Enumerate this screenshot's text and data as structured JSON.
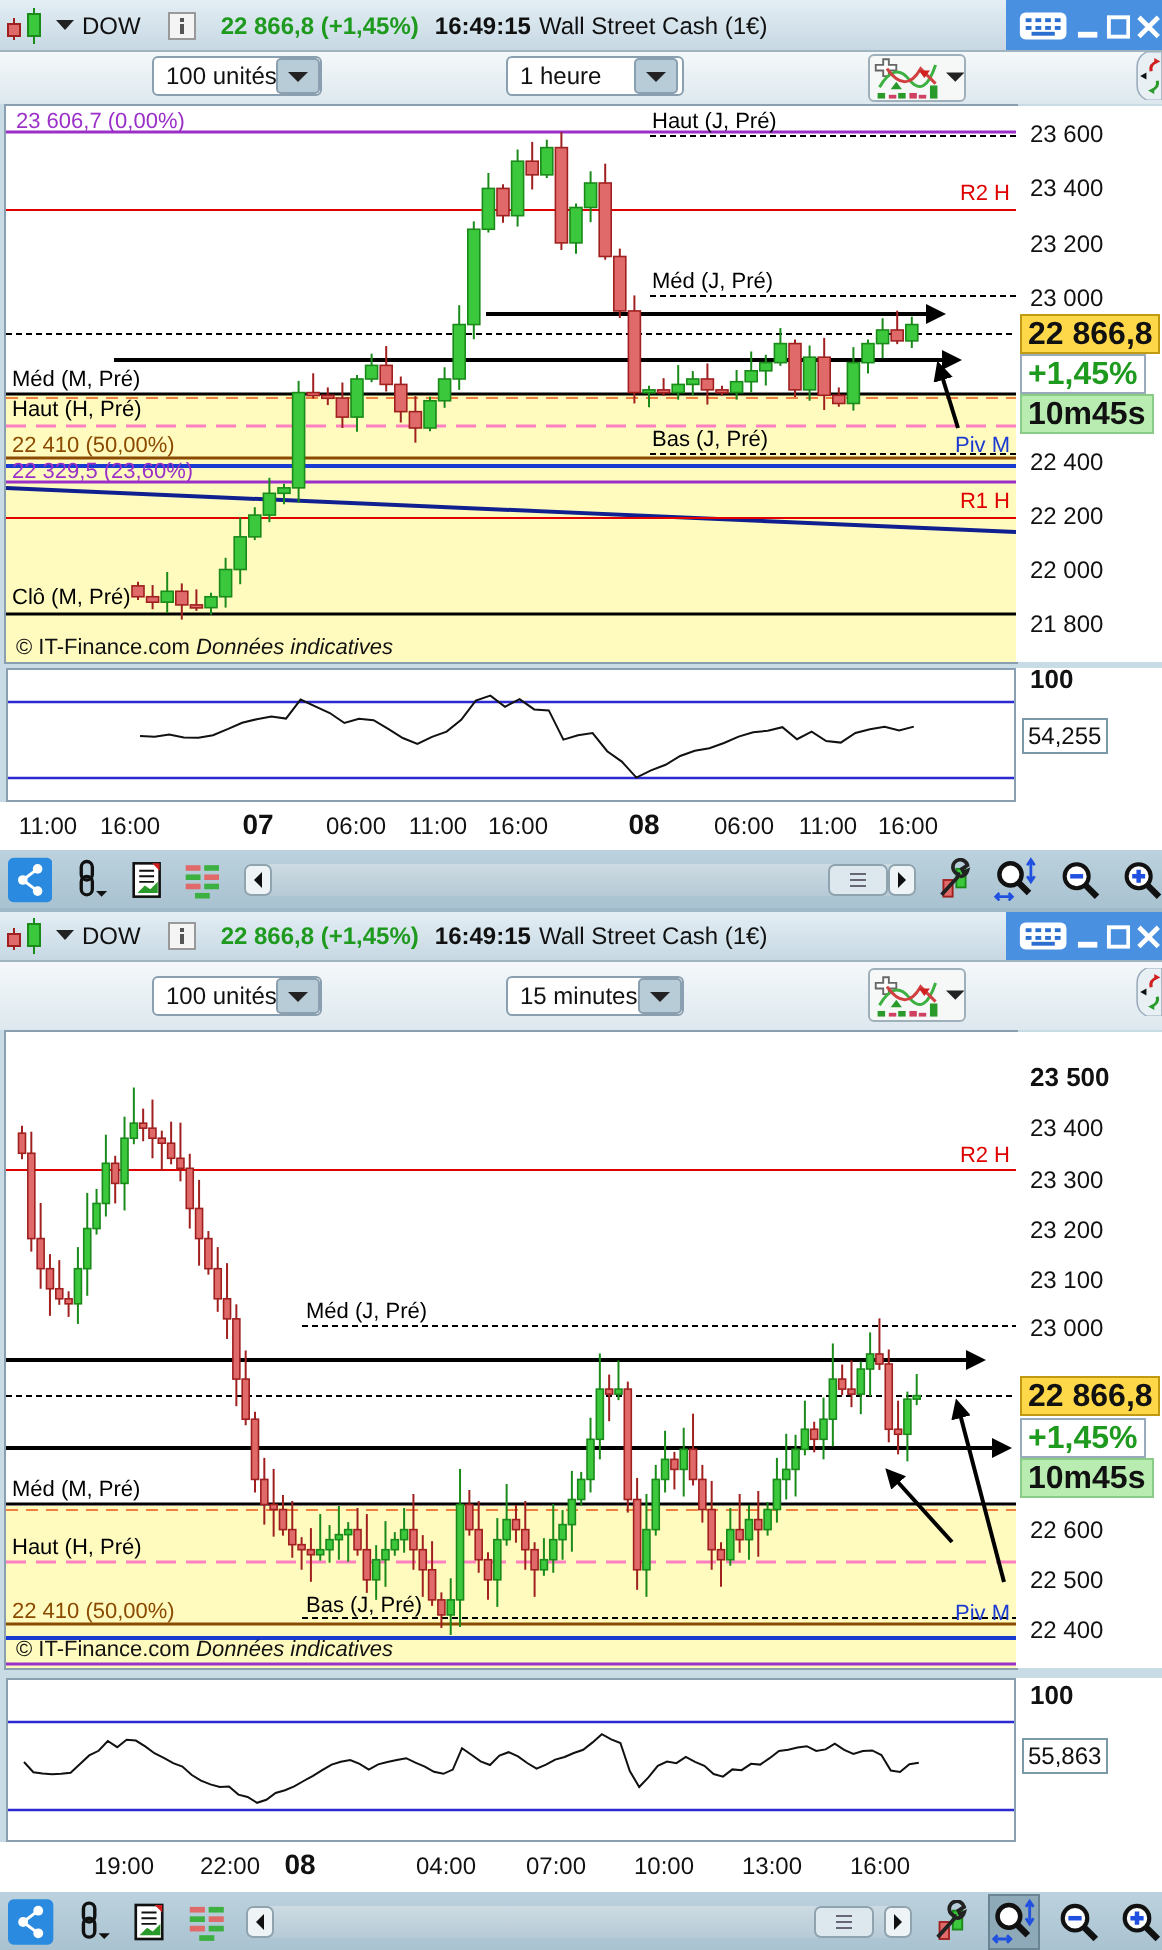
{
  "panels": [
    {
      "header": {
        "symbol": "DOW",
        "quote": "22 866,8 (+1,45%)",
        "time": "16:49:15",
        "instrument": "Wall Street Cash (1€)"
      },
      "controls": {
        "quantity": "100 unités",
        "interval": "1 heure"
      },
      "level_labels": [
        {
          "text": "23 606,7 (0,00%)",
          "color": "#9b30c8"
        },
        {
          "text": "Haut (J, Pré)",
          "color": "#000000"
        },
        {
          "text": "R2 H",
          "color": "#e00000"
        },
        {
          "text": "Méd (J, Pré)",
          "color": "#000000"
        },
        {
          "text": "Méd (M, Pré)",
          "color": "#000000"
        },
        {
          "text": "Haut (H, Pré)",
          "color": "#000000"
        },
        {
          "text": "22 410 (50,00%)",
          "color": "#8a4a00"
        },
        {
          "text": "22 329,5 (23,60%)",
          "color": "#9b30c8"
        },
        {
          "text": "Bas (J, Pré)",
          "color": "#000000"
        },
        {
          "text": "Piv M",
          "color": "#1a3ad0"
        },
        {
          "text": "R1 H",
          "color": "#e00000"
        },
        {
          "text": "Clô (M, Pré)",
          "color": "#000000"
        }
      ],
      "credit": "© IT-Finance.com *Données indicatives*",
      "price_axis": [
        {
          "label": "23 600",
          "bold": false
        },
        {
          "label": "23 400",
          "bold": false
        },
        {
          "label": "23 200",
          "bold": false
        },
        {
          "label": "23 000",
          "bold": false
        },
        {
          "label": "22 400",
          "bold": false
        },
        {
          "label": "22 200",
          "bold": false
        },
        {
          "label": "22 000",
          "bold": false
        },
        {
          "label": "21 800",
          "bold": false
        }
      ],
      "price_tag": "22 866,8",
      "change": "+1,45%",
      "countdown": "10m45s",
      "oscillator": {
        "top_tick": "100",
        "value": "54,255"
      },
      "time_axis": [
        {
          "label": "11:00",
          "bold": false
        },
        {
          "label": "16:00",
          "bold": false
        },
        {
          "label": "07",
          "bold": true
        },
        {
          "label": "06:00",
          "bold": false
        },
        {
          "label": "11:00",
          "bold": false
        },
        {
          "label": "16:00",
          "bold": false
        },
        {
          "label": "08",
          "bold": true
        },
        {
          "label": "06:00",
          "bold": false
        },
        {
          "label": "11:00",
          "bold": false
        },
        {
          "label": "16:00",
          "bold": false
        }
      ],
      "toolbar": {
        "zoom_fit_selected": false
      }
    },
    {
      "header": {
        "symbol": "DOW",
        "quote": "22 866,8 (+1,45%)",
        "time": "16:49:15",
        "instrument": "Wall Street Cash (1€)"
      },
      "controls": {
        "quantity": "100 unités",
        "interval": "15 minutes"
      },
      "level_labels": [
        {
          "text": "R2 H",
          "color": "#e00000"
        },
        {
          "text": "Méd (J, Pré)",
          "color": "#000000"
        },
        {
          "text": "Méd (M, Pré)",
          "color": "#000000"
        },
        {
          "text": "Haut (H, Pré)",
          "color": "#000000"
        },
        {
          "text": "22 410 (50,00%)",
          "color": "#8a4a00"
        },
        {
          "text": "Bas (J, Pré)",
          "color": "#000000"
        },
        {
          "text": "Piv M",
          "color": "#1a3ad0"
        }
      ],
      "credit": "© IT-Finance.com *Données indicatives*",
      "price_axis": [
        {
          "label": "23 500",
          "bold": true
        },
        {
          "label": "23 400",
          "bold": false
        },
        {
          "label": "23 300",
          "bold": false
        },
        {
          "label": "23 200",
          "bold": false
        },
        {
          "label": "23 100",
          "bold": false
        },
        {
          "label": "23 000",
          "bold": false
        },
        {
          "label": "22 600",
          "bold": false
        },
        {
          "label": "22 500",
          "bold": false
        },
        {
          "label": "22 400",
          "bold": false
        }
      ],
      "price_tag": "22 866,8",
      "change": "+1,45%",
      "countdown": "10m45s",
      "oscillator": {
        "top_tick": "100",
        "value": "55,863"
      },
      "time_axis": [
        {
          "label": "19:00",
          "bold": false
        },
        {
          "label": "22:00",
          "bold": false
        },
        {
          "label": "08",
          "bold": true
        },
        {
          "label": "04:00",
          "bold": false
        },
        {
          "label": "07:00",
          "bold": false
        },
        {
          "label": "10:00",
          "bold": false
        },
        {
          "label": "13:00",
          "bold": false
        },
        {
          "label": "16:00",
          "bold": false
        }
      ],
      "toolbar": {
        "zoom_fit_selected": true
      }
    }
  ]
}
